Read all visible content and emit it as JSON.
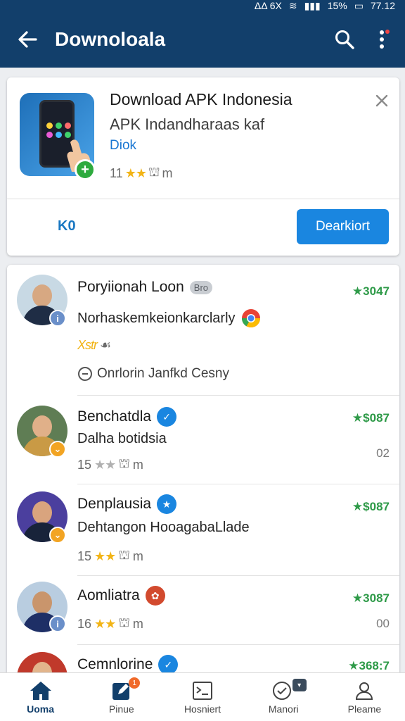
{
  "status": {
    "left": "ΔΔ 6X",
    "battery": "15%",
    "time": "77.12"
  },
  "app_bar": {
    "title": "Downoloala"
  },
  "promo": {
    "title": "Download APK Indonesia",
    "subtitle": "APK Indandharaas kaf",
    "link": "Diok",
    "rating_prefix": "11",
    "rating_suffix": "m",
    "secondary_action": "K0",
    "primary_action": "Dearkiort"
  },
  "list": [
    {
      "name": "Poryiionah Loon",
      "tag": "Bro",
      "description": "Norhaskemkeionkarclarly",
      "rating_text": "Xstr",
      "note": "Onrlorin Janfkd Cesny",
      "price": "3047"
    },
    {
      "name": "Benchatdla",
      "description": "Dalha botidsia",
      "rating_prefix": "15",
      "rating_suffix": "m",
      "price": "$087",
      "count": "02"
    },
    {
      "name": "Denplausia",
      "description": "Dehtangon HooagabaLlade",
      "rating_prefix": "15",
      "rating_suffix": "m",
      "price": "$087"
    },
    {
      "name": "Aomliatra",
      "rating_prefix": "16",
      "rating_suffix": "m",
      "price": "3087",
      "count": "00"
    },
    {
      "name": "Cemnlorine",
      "price": "368:7"
    }
  ],
  "bottom_nav": [
    {
      "label": "Uoma",
      "icon": "home-icon"
    },
    {
      "label": "Pinue",
      "icon": "edit-icon",
      "badge": "1"
    },
    {
      "label": "Hosniert",
      "icon": "terminal-icon"
    },
    {
      "label": "Manori",
      "icon": "chat-icon"
    },
    {
      "label": "Pleame",
      "icon": "profile-icon"
    }
  ],
  "colors": {
    "app_bar": "#123f6b",
    "primary": "#1a86e0",
    "price": "#2e9a48",
    "star": "#f2b416"
  }
}
